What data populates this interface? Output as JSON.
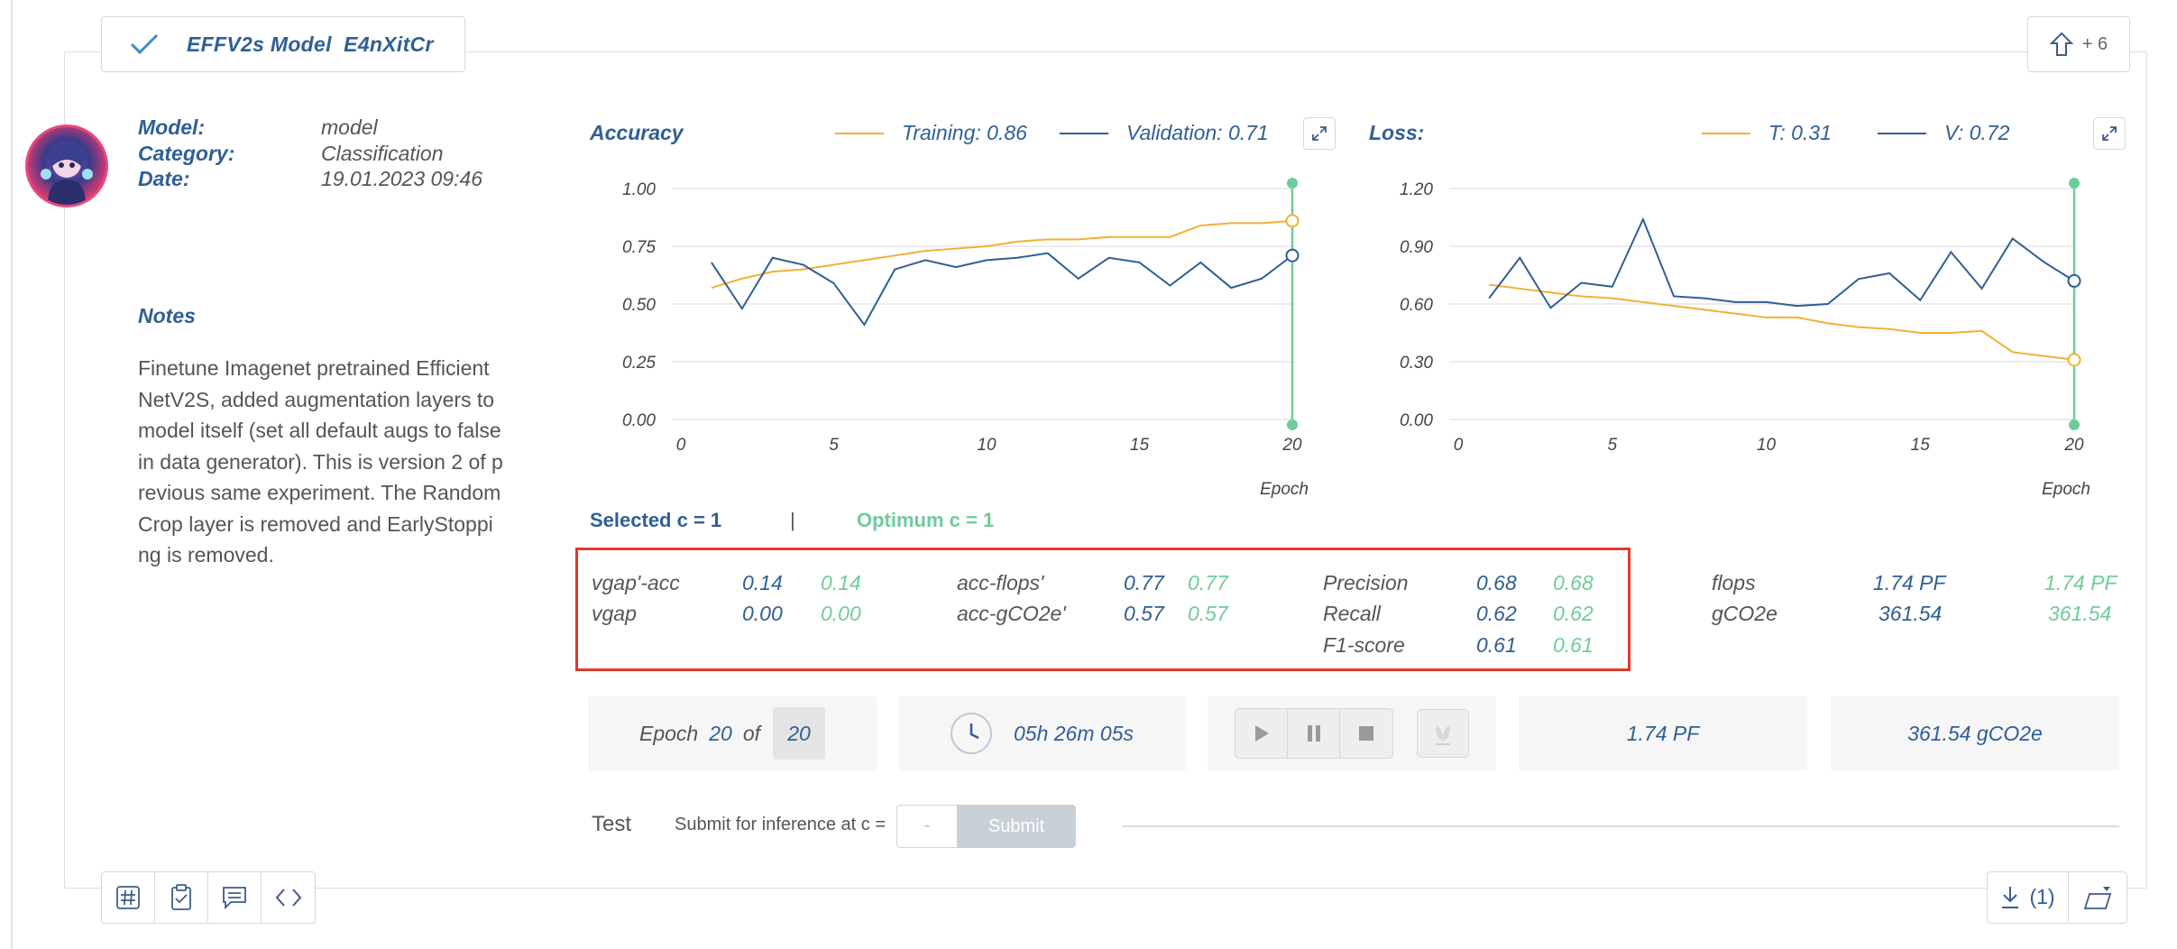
{
  "card": {
    "title": "EFFV2s Model  E4nXitCr",
    "share_count": "+ 6",
    "icons": [
      "check-icon",
      "upload-share-icon",
      "avatar-image"
    ]
  },
  "meta": {
    "model_label": "Model:",
    "model_value": "model",
    "category_label": "Category:",
    "category_value": "Classification",
    "date_label": "Date:",
    "date_value": "19.01.2023 09:46"
  },
  "notes": {
    "title": "Notes",
    "body": "Finetune Imagenet pretrained EfficientNetV2S, added augmentation layers to model itself (set all default augs to false in data generator). This is version 2 of previous same experiment. The RandomCrop layer is removed and EarlyStopping is removed."
  },
  "accuracy_chart": {
    "title": "Accuracy",
    "legend_training": "Training: 0.86",
    "legend_validation": "Validation: 0.71"
  },
  "loss_chart": {
    "title": "Loss:",
    "legend_training": "T: 0.31",
    "legend_validation": "V: 0.72"
  },
  "chart_data": [
    {
      "type": "line",
      "title": "Accuracy",
      "xlabel": "Epoch",
      "ylabel": "",
      "xlim": [
        0,
        20
      ],
      "ylim": [
        0,
        1
      ],
      "xticks": [
        "0",
        "5",
        "10",
        "15",
        "20"
      ],
      "yticks": [
        "0.00",
        "0.25",
        "0.50",
        "0.75",
        "1.00"
      ],
      "grid": true,
      "marker_epoch": 20,
      "x": [
        1,
        2,
        3,
        4,
        5,
        6,
        7,
        8,
        9,
        10,
        11,
        12,
        13,
        14,
        15,
        16,
        17,
        18,
        19,
        20
      ],
      "series": [
        {
          "name": "Training",
          "color": "#f2b134",
          "values": [
            0.57,
            0.61,
            0.64,
            0.65,
            0.67,
            0.69,
            0.71,
            0.73,
            0.74,
            0.75,
            0.77,
            0.78,
            0.78,
            0.79,
            0.79,
            0.79,
            0.84,
            0.85,
            0.85,
            0.86
          ]
        },
        {
          "name": "Validation",
          "color": "#2f5f95",
          "values": [
            0.68,
            0.48,
            0.7,
            0.67,
            0.59,
            0.41,
            0.65,
            0.69,
            0.66,
            0.69,
            0.7,
            0.72,
            0.61,
            0.7,
            0.68,
            0.58,
            0.68,
            0.57,
            0.61,
            0.71
          ]
        }
      ]
    },
    {
      "type": "line",
      "title": "Loss:",
      "xlabel": "Epoch",
      "ylabel": "",
      "xlim": [
        0,
        20
      ],
      "ylim": [
        0,
        1.2
      ],
      "xticks": [
        "0",
        "5",
        "10",
        "15",
        "20"
      ],
      "yticks": [
        "0.00",
        "0.30",
        "0.60",
        "0.90",
        "1.20"
      ],
      "grid": true,
      "marker_epoch": 20,
      "x": [
        1,
        2,
        3,
        4,
        5,
        6,
        7,
        8,
        9,
        10,
        11,
        12,
        13,
        14,
        15,
        16,
        17,
        18,
        19,
        20
      ],
      "series": [
        {
          "name": "T",
          "color": "#f2b134",
          "values": [
            0.7,
            0.68,
            0.66,
            0.64,
            0.63,
            0.61,
            0.59,
            0.57,
            0.55,
            0.53,
            0.53,
            0.5,
            0.48,
            0.47,
            0.45,
            0.45,
            0.46,
            0.35,
            0.33,
            0.31
          ]
        },
        {
          "name": "V",
          "color": "#2f5f95",
          "values": [
            0.63,
            0.84,
            0.58,
            0.71,
            0.69,
            1.04,
            0.64,
            0.63,
            0.61,
            0.61,
            0.59,
            0.6,
            0.73,
            0.76,
            0.62,
            0.87,
            0.68,
            0.94,
            0.82,
            0.72
          ]
        }
      ]
    }
  ],
  "selection": {
    "selected": "Selected c = 1",
    "separator": "|",
    "optimum": "Optimum c = 1"
  },
  "metrics": {
    "vgap_acc_label": "vgap'-acc",
    "vgap_acc_sel": "0.14",
    "vgap_acc_opt": "0.14",
    "vgap_label": "vgap",
    "vgap_sel": "0.00",
    "vgap_opt": "0.00",
    "acc_flops_label": "acc-flops'",
    "acc_flops_sel": "0.77",
    "acc_flops_opt": "0.77",
    "acc_gco2e_label": "acc-gCO2e'",
    "acc_gco2e_sel": "0.57",
    "acc_gco2e_opt": "0.57",
    "precision_label": "Precision",
    "precision_sel": "0.68",
    "precision_opt": "0.68",
    "recall_label": "Recall",
    "recall_sel": "0.62",
    "recall_opt": "0.62",
    "f1_label": "F1-score",
    "f1_sel": "0.61",
    "f1_opt": "0.61",
    "flops_label": "flops",
    "flops_sel": "1.74 PF",
    "flops_opt": "1.74 PF",
    "gco2e_label": "gCO2e",
    "gco2e_sel": "361.54",
    "gco2e_opt": "361.54"
  },
  "stats": {
    "epoch_label": "Epoch",
    "epoch_current": "20",
    "epoch_of": "of",
    "epoch_total": "20",
    "duration": "05h 26m 05s",
    "flops": "1.74 PF",
    "emissions": "361.54 gCO2e"
  },
  "test": {
    "label": "Test",
    "description": "Submit for inference at c =",
    "input_placeholder": "-",
    "submit_label": "Submit"
  },
  "footer": {
    "download_count": "(1)"
  },
  "colors": {
    "accent_blue": "#2f5f95",
    "accent_green": "#6fcb9a",
    "training_orange": "#f2b134",
    "highlight_red": "#e0382b"
  }
}
